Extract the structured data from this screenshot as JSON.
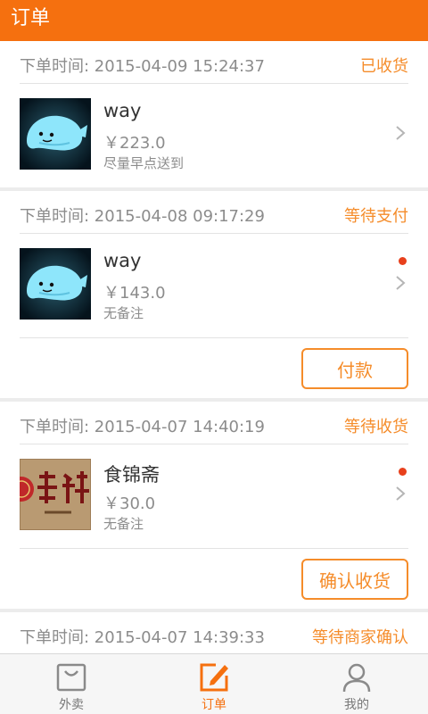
{
  "header": {
    "title": "订单"
  },
  "orders": [
    {
      "time_label": "下单时间: 2015-04-09 15:24:37",
      "status": "已收货",
      "shop": "way",
      "price": "￥223.0",
      "note": "尽量早点送到",
      "image": "whale-lamp-photo",
      "unread": false,
      "action": ""
    },
    {
      "time_label": "下单时间: 2015-04-08 09:17:29",
      "status": "等待支付",
      "shop": "way",
      "price": "￥143.0",
      "note": "无备注",
      "image": "whale-lamp-photo",
      "unread": true,
      "action": "付款"
    },
    {
      "time_label": "下单时间: 2015-04-07 14:40:19",
      "status": "等待收货",
      "shop": "食锦斋",
      "price": "￥30.0",
      "note": "无备注",
      "image": "shop-logo-shijinzhai",
      "unread": true,
      "action": "确认收货"
    },
    {
      "time_label": "下单时间: 2015-04-07 14:39:33",
      "status": "等待商家确认"
    }
  ],
  "tabs": [
    {
      "label": "外卖",
      "icon": "bag-icon",
      "active": false
    },
    {
      "label": "订单",
      "icon": "edit-icon",
      "active": true
    },
    {
      "label": "我的",
      "icon": "user-icon",
      "active": false
    }
  ],
  "colors": {
    "brand": "#f5700f",
    "status": "#f58c2a",
    "unread_dot": "#e8401c"
  }
}
